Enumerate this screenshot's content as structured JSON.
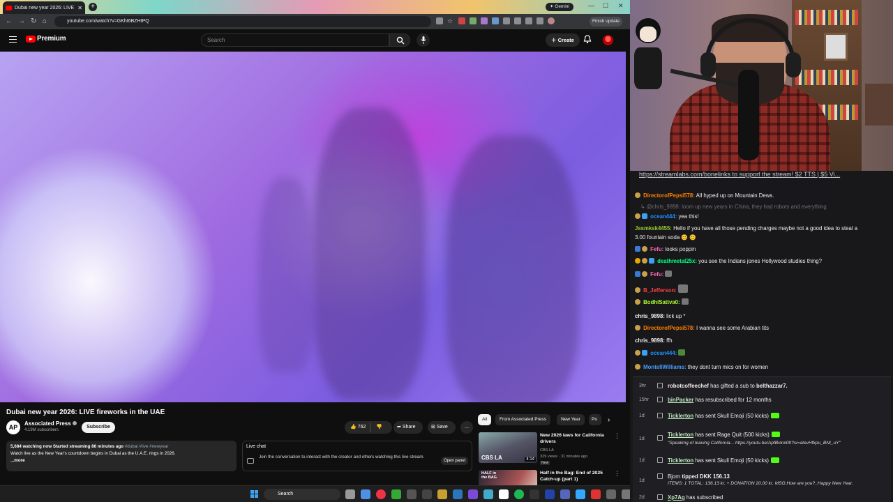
{
  "browser": {
    "tab_title": "Dubai new year 2026: LIVE",
    "gemini": "Gemini",
    "url": "youtube.com/watch?v=GKht6BZHtPQ",
    "finish_update": "Finish update"
  },
  "yt_header": {
    "brand": "Premium",
    "search_placeholder": "Search",
    "create_label": "Create"
  },
  "video": {
    "title": "Dubai new year 2026: LIVE fireworks in the UAE",
    "channel_initials": "AP",
    "channel": "Associated Press",
    "subscribers": "4.19M subscribers",
    "subscribe_label": "Subscribe",
    "likes": "762",
    "share_label": "Share",
    "save_label": "Save",
    "more_label": "..."
  },
  "description": {
    "stats": "5,684 watching now  Started streaming 86 minutes ago",
    "hashtags": "#dubai #live #newyear",
    "text": "Watch live as the New Year's countdown begins in Dubai as the U.A.E. rings in 2026.",
    "more": "...more"
  },
  "live_chat": {
    "heading": "Live chat",
    "text": "Join the conversation to interact with the creator and others watching this live stream.",
    "open_panel": "Open panel"
  },
  "chips": [
    "All",
    "From Associated Press",
    "New Year",
    "Po"
  ],
  "recommendations": [
    {
      "title": "New 2026 laws for California drivers",
      "channel": "CBS LA",
      "meta": "329 views · 31 minutes ago",
      "badge": "New",
      "duration": "4:14",
      "thumb_label": "CBS LA"
    },
    {
      "title": "Half in the Bag: End of 2025 Catch-up (part 1)",
      "thumb_label": "HALF in the BAG"
    }
  ],
  "taskbar": {
    "search": "Search"
  },
  "chat": {
    "pinned": "https://streamlabs.com/bonelinks to support the stream! $2 TTS | $5 Vi...",
    "messages": [
      {
        "user": "DirectorofPepsi578:",
        "text": " All hyped up on Mountain Dews.",
        "color": "#ff7f00"
      },
      {
        "user": "@chris_9898:",
        "text": " loom up new years in China, they had robots and everything",
        "color": "#6d6d74",
        "muted": true
      },
      {
        "user": "ocean444:",
        "text": " yea this!",
        "color": "#1e90ff"
      },
      {
        "user": "Jssmksk4455:",
        "text": " Hello if you have all those pending charges maybe not a good idea to steal a",
        "color": "#9acd32"
      },
      {
        "user": "",
        "text": "3.00 fountain soda 😊 😊",
        "color": "#efeff1"
      },
      {
        "user": "Fefu:",
        "text": " looks poppin",
        "color": "#ff69b4"
      },
      {
        "user": "deathmetal25x:",
        "text": " you see the Indians jones Hollywood studies thing?",
        "color": "#00ff7f"
      },
      {
        "user": "Fefu:",
        "text": "",
        "color": "#ff69b4"
      },
      {
        "user": "B_Jefferson:",
        "text": "",
        "color": "#ff4040"
      },
      {
        "user": "BodhiSattva0:",
        "text": "",
        "color": "#adff2f"
      },
      {
        "user": "chris_9898:",
        "text": " lick up *",
        "color": "#efeff1"
      },
      {
        "user": "DirectorofPepsi578:",
        "text": " I wanna see some Arabian tits",
        "color": "#ff7f00"
      },
      {
        "user": "chris_9898:",
        "text": " ffh",
        "color": "#efeff1"
      },
      {
        "user": "ocean444:",
        "text": "",
        "color": "#1e90ff"
      },
      {
        "user": "MontellWilliams:",
        "text": " they dont turn mics on for women",
        "color": "#4a9dff"
      }
    ]
  },
  "events": [
    {
      "time": "3hr",
      "name": "robotcoffeechef",
      "text": " has gifted a sub to ",
      "target": "belthazzar7.",
      "sub": ""
    },
    {
      "time": "15hr",
      "name": "binPacker",
      "text": " has resubscribed for 12 months",
      "target": "",
      "sub": ""
    },
    {
      "time": "1d",
      "name": "Ticklerton",
      "text": " has sent Skull Emoji (50 kicks)",
      "target": "",
      "sub": ""
    },
    {
      "time": "1d",
      "name": "Ticklerton",
      "text": " has sent Rage Quit (500 kicks)",
      "target": "",
      "sub": "\"Speaking of leaving California... https://youtu.be/ApfBvkol0II?si=atevHfkpu_BNt_uY\""
    },
    {
      "time": "1d",
      "name": "Ticklerton",
      "text": " has sent Skull Emoji (50 kicks)",
      "target": "",
      "sub": ""
    },
    {
      "time": "1d",
      "name": "Bjorn",
      "text": " tipped DKK 156.13",
      "target": "",
      "sub": "ITEMS: 1 TOTAL: 136.13 kr. + DONATION 20.00 kr. MSG:How are you?_Happy New Year."
    },
    {
      "time": "2d",
      "name": "Xp7Ag",
      "text": " has subscribed",
      "target": "",
      "sub": ""
    }
  ]
}
